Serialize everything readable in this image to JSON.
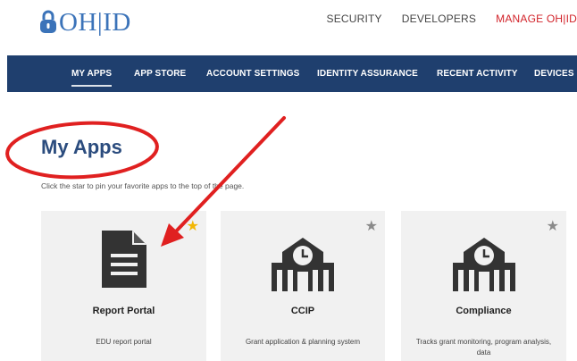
{
  "header": {
    "logo_text": "OH|ID",
    "topnav": [
      {
        "label": "SECURITY",
        "active": false
      },
      {
        "label": "DEVELOPERS",
        "active": false
      },
      {
        "label": "MANAGE OH|ID",
        "active": true
      }
    ]
  },
  "navbar": {
    "items": [
      {
        "label": "MY APPS",
        "active": true
      },
      {
        "label": "APP STORE",
        "active": false
      },
      {
        "label": "ACCOUNT SETTINGS",
        "active": false
      },
      {
        "label": "IDENTITY ASSURANCE",
        "active": false
      },
      {
        "label": "RECENT ACTIVITY",
        "active": false
      },
      {
        "label": "DEVICES",
        "active": false
      }
    ]
  },
  "main": {
    "title": "My Apps",
    "subtitle": "Click the star to pin your favorite apps to the top of the page."
  },
  "apps": [
    {
      "name": "Report Portal",
      "description": "EDU report portal",
      "icon": "document-icon",
      "favorited": true
    },
    {
      "name": "CCIP",
      "description": "Grant application & planning system",
      "icon": "building-clock-icon",
      "favorited": false
    },
    {
      "name": "Compliance",
      "description": "Tracks grant monitoring, program analysis, data",
      "icon": "building-clock-icon",
      "favorited": false
    }
  ],
  "colors": {
    "brand_blue": "#3b73b9",
    "nav_bg": "#1f3f6e",
    "active_red": "#d2232a",
    "star_gold": "#f2b705",
    "star_gray": "#8a8a8a",
    "annotation_red": "#e02020"
  }
}
